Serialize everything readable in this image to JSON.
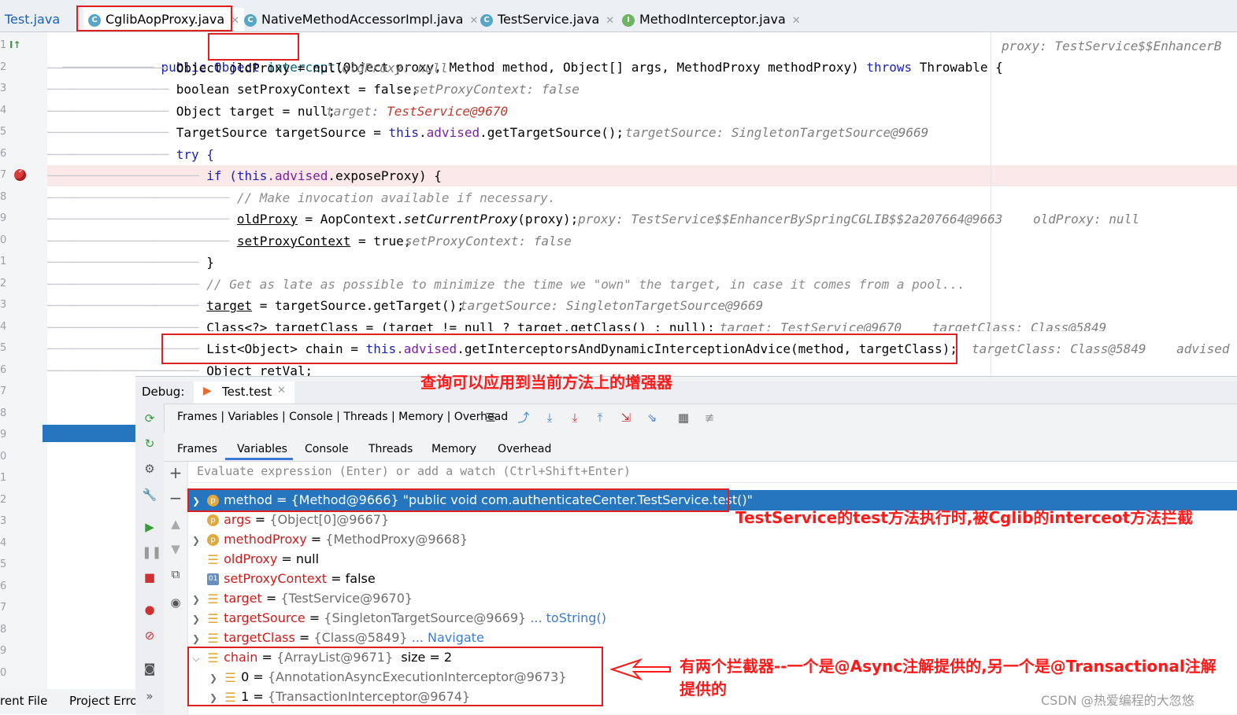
{
  "tabs": [
    {
      "label": "Test.java",
      "icon": "class-icon"
    },
    {
      "label": "CglibAopProxy.java",
      "icon": "class-icon"
    },
    {
      "label": "NativeMethodAccessorImpl.java",
      "icon": "class-icon"
    },
    {
      "label": "TestService.java",
      "icon": "class-icon"
    },
    {
      "label": "MethodInterceptor.java",
      "icon": "interface-icon"
    }
  ],
  "code": {
    "l1_a": "public Object ",
    "l1_method": "intercept",
    "l1_b": "(Object proxy, Method method, Object[] args, MethodProxy methodProxy) ",
    "l1_throws": "throws",
    "l1_c": " Throwable {",
    "l1_hint": "proxy: TestService$$EnhancerB",
    "l2_code": "Object oldProxy = null;",
    "l2_hint": "oldProxy: null",
    "l3_code": "boolean setProxyContext = false;",
    "l3_hint": "setProxyContext: false",
    "l4_code": "Object target = null;",
    "l4_hint_label": "target: ",
    "l4_hint_value": "TestService@9670",
    "l5_code_a": "TargetSource targetSource = ",
    "l5_this": "this",
    "l5_dot": ".",
    "l5_advised": "advised",
    "l5_code_b": ".getTargetSource();",
    "l5_hint": "targetSource: SingletonTargetSource@9669",
    "l6_code": "try {",
    "l7_if": "if (",
    "l7_this": "this",
    "l7_advised": ".advised",
    "l7_rest": ".exposeProxy) {",
    "l8_comment": "// Make invocation available if necessary.",
    "l9_code_a": "oldProxy",
    "l9_code_b": " = AopContext.",
    "l9_code_c": "setCurrentProxy",
    "l9_code_d": "(proxy);",
    "l9_hint": "proxy: TestService$$EnhancerBySpringCGLIB$$2a207664@9663    oldProxy: null",
    "l10_code_a": "setProxyContext",
    "l10_code_b": " = true;",
    "l10_hint": "setProxyContext: false",
    "l11_code": "}",
    "l12_comment": "// Get as late as possible to minimize the time we \"own\" the target, in case it comes from a pool...",
    "l13_code_a": "target",
    "l13_code_b": " = targetSource.getTarget();",
    "l13_hint": "targetSource: SingletonTargetSource@9669",
    "l14_code": "Class<?> targetClass = (target != null ? target.getClass() : null);",
    "l14_hint": "target: TestService@9670    targetClass: Class@5849",
    "l15_code_a": "List<Object> chain = ",
    "l15_this": "this",
    "l15_advised": ".advised",
    "l15_code_b": ".getInterceptorsAndDynamicInterceptionAdvice(method, targetClass);",
    "l15_hint": "targetClass: Class@5849    advised",
    "l16_code": "Object retVal;"
  },
  "line_numbers": [
    "1",
    "2",
    "3",
    "4",
    "5",
    "6",
    "7",
    "8",
    "9",
    "0",
    "1",
    "2",
    "3",
    "4",
    "5",
    "6",
    "7",
    "8",
    "9",
    "0",
    "1",
    "2",
    "3",
    "4",
    "5",
    "6",
    "7",
    "8",
    "9",
    "0",
    "1"
  ],
  "debug": {
    "label": "Debug:",
    "session_tab": "Test.test",
    "toolbar_text": "Frames | Variables | Console | Threads | Memory | Overhead",
    "subtabs": [
      "Frames",
      "Variables",
      "Console",
      "Threads",
      "Memory",
      "Overhead"
    ],
    "eval_placeholder": "Evaluate expression (Enter) or add a watch (Ctrl+Shift+Enter)"
  },
  "variables": [
    {
      "name": "method",
      "eq": " = ",
      "value": "{Method@9666} \"public void com.authenticateCenter.TestService.test()\"",
      "icon": "p",
      "expanded": false,
      "selected": true
    },
    {
      "name": "args",
      "eq": " = ",
      "value": "{Object[0]@9667}",
      "icon": "p",
      "expanded": null
    },
    {
      "name": "methodProxy",
      "eq": " = ",
      "value": "{MethodProxy@9668}",
      "icon": "p",
      "expanded": false
    },
    {
      "name": "oldProxy",
      "eq": " = ",
      "value": "null",
      "icon": "field",
      "expanded": null
    },
    {
      "name": "setProxyContext",
      "eq": " = ",
      "value": "false",
      "icon": "01",
      "expanded": null
    },
    {
      "name": "target",
      "eq": " = ",
      "value": "{TestService@9670}",
      "icon": "field",
      "expanded": false
    },
    {
      "name": "targetSource",
      "eq": " = ",
      "value": "{SingletonTargetSource@9669}",
      "link": "... toString()",
      "icon": "field",
      "expanded": false
    },
    {
      "name": "targetClass",
      "eq": " = ",
      "value": "{Class@5849}",
      "link": "... Navigate",
      "icon": "field",
      "expanded": false
    },
    {
      "name": "chain",
      "eq": " = ",
      "value": "{ArrayList@9671}",
      "extra": "  size = 2",
      "icon": "field",
      "expanded": true
    },
    {
      "name": "0",
      "eq": " = ",
      "value": "{AnnotationAsyncExecutionInterceptor@9673}",
      "icon": "field",
      "expanded": false,
      "child": true
    },
    {
      "name": "1",
      "eq": " = ",
      "value": "{TransactionInterceptor@9674}",
      "icon": "field",
      "expanded": false,
      "child": true
    }
  ],
  "annotations": {
    "a1": "查询可以应用到当前方法上的增强器",
    "a2": "TestService的test方法执行时,被Cglib的interceot方法拦截",
    "a3_line1": "有两个拦截器--一个是@Async注解提供的,另一个是@Transactional注解",
    "a3_line2": "提供的"
  },
  "bottom": {
    "left1": "rent File",
    "left2": "Project Erro",
    "watermark": "CSDN @热爱编程的大忽悠"
  },
  "colors": {
    "selection": "#2675bf",
    "annotation_red": "#ff1a1a",
    "keyword_blue": "#1b23b5",
    "field_purple": "#7a1fa2",
    "breakpoint_line": "#fbe8e8"
  }
}
